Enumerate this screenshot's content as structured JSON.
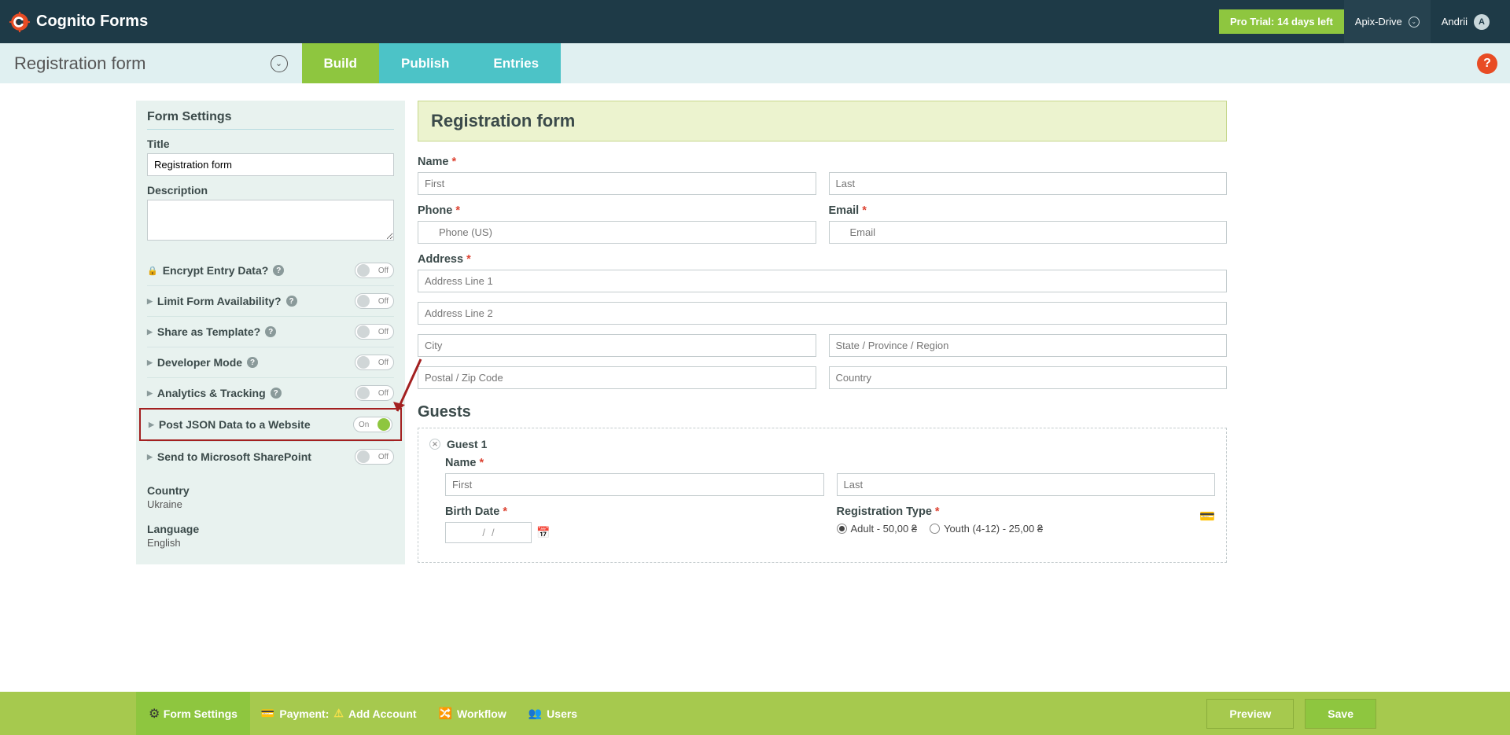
{
  "header": {
    "brand": "Cognito Forms",
    "pro_trial": "Pro Trial: 14 days left",
    "org": "Apix-Drive",
    "user": "Andrii",
    "avatar_initial": "A"
  },
  "subheader": {
    "form_name": "Registration form",
    "tabs": {
      "build": "Build",
      "publish": "Publish",
      "entries": "Entries"
    },
    "help": "?"
  },
  "sidebar": {
    "heading": "Form Settings",
    "title_label": "Title",
    "title_value": "Registration form",
    "description_label": "Description",
    "settings": [
      {
        "label": "Encrypt Entry Data?",
        "icon": "lock",
        "state": "Off"
      },
      {
        "label": "Limit Form Availability?",
        "icon": "tri",
        "state": "Off"
      },
      {
        "label": "Share as Template?",
        "icon": "tri",
        "state": "Off"
      },
      {
        "label": "Developer Mode",
        "icon": "tri",
        "state": "Off"
      },
      {
        "label": "Analytics & Tracking",
        "icon": "tri",
        "state": "Off"
      },
      {
        "label": "Post JSON Data to a Website",
        "icon": "tri",
        "state": "On",
        "highlight": true
      },
      {
        "label": "Send to Microsoft SharePoint",
        "icon": "tri",
        "state": "Off"
      }
    ],
    "country_label": "Country",
    "country_value": "Ukraine",
    "language_label": "Language",
    "language_value": "English"
  },
  "form": {
    "title": "Registration form",
    "name_label": "Name",
    "first_ph": "First",
    "last_ph": "Last",
    "phone_label": "Phone",
    "phone_ph": "Phone (US)",
    "email_label": "Email",
    "email_ph": "Email",
    "address_label": "Address",
    "addr1_ph": "Address Line 1",
    "addr2_ph": "Address Line 2",
    "city_ph": "City",
    "state_ph": "State / Province / Region",
    "postal_ph": "Postal / Zip Code",
    "country_ph": "Country",
    "guests_heading": "Guests",
    "guest1_label": "Guest 1",
    "guest_name_label": "Name",
    "birth_label": "Birth Date",
    "date_ph": "/    /",
    "regtype_label": "Registration Type",
    "reg_adult": "Adult - 50,00 ₴",
    "reg_youth": "Youth (4-12) - 25,00 ₴"
  },
  "bottombar": {
    "form_settings": "Form Settings",
    "payment": "Payment:",
    "add_account": "Add Account",
    "workflow": "Workflow",
    "users": "Users",
    "preview": "Preview",
    "save": "Save"
  }
}
